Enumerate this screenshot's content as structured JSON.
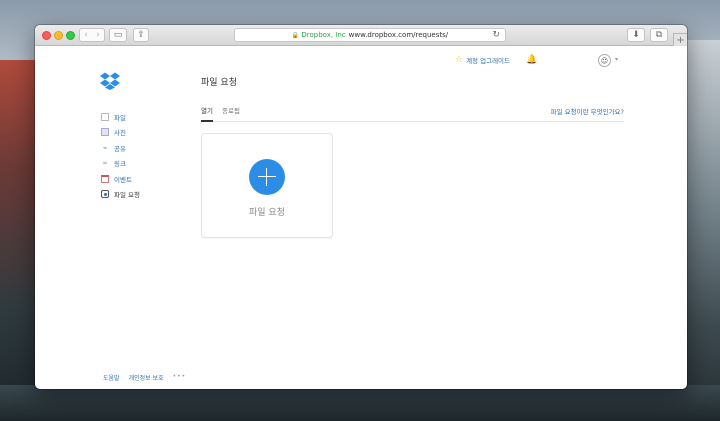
{
  "browser": {
    "url_org": "Dropbox, Inc",
    "url": "www.dropbox.com/requests/"
  },
  "header": {
    "title": "파일 요청",
    "upgrade_label": "계정 업그레이드"
  },
  "sidebar": {
    "items": [
      {
        "label": "파일",
        "icon": "file-icon"
      },
      {
        "label": "사진",
        "icon": "photo-icon"
      },
      {
        "label": "공유",
        "icon": "share-folder-icon"
      },
      {
        "label": "링크",
        "icon": "link-icon"
      },
      {
        "label": "이벤트",
        "icon": "calendar-icon"
      },
      {
        "label": "파일 요청",
        "icon": "file-request-icon",
        "active": true
      }
    ]
  },
  "tabs": {
    "open": "열기",
    "closed": "종료됨",
    "help_link": "파일 요청이란 무엇인가요?"
  },
  "card": {
    "label": "파일 요청"
  },
  "footer": {
    "help": "도움말",
    "privacy": "개인정보 보호",
    "more": "•••"
  },
  "colors": {
    "accent": "#2c8de6",
    "link": "#2d6fb6"
  }
}
